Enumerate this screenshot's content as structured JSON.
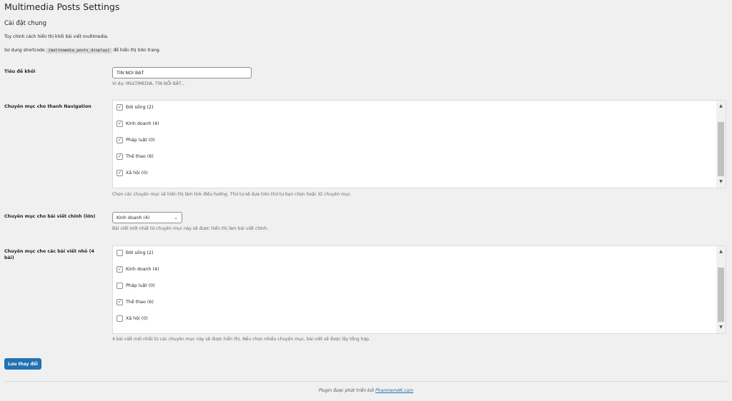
{
  "page_title": "Multimedia Posts Settings",
  "section_title": "Cài đặt chung",
  "intro": {
    "line1": "Tùy chỉnh cách hiển thị khối bài viết multimedia.",
    "line2_prefix": "Sử dụng shortcode",
    "shortcode": "[multimedia_posts_display]",
    "line2_suffix": "để hiển thị trên trang."
  },
  "block_title": {
    "label": "Tiêu đề khối",
    "value": "TIN NỔI BẬT",
    "help": "Ví dụ: MULTIMEDIA, TIN NỔI BẬT..."
  },
  "nav_categories": {
    "label": "Chuyên mục cho thanh Navigation",
    "help": "Chọn các chuyên mục sẽ hiển thị làm link điều hướng. Thứ tự sẽ dựa trên thứ tự bạn chọn hoặc ID chuyên mục.",
    "items": [
      {
        "label": "Đời sống (2)",
        "checked": true
      },
      {
        "label": "Kinh doanh (4)",
        "checked": true
      },
      {
        "label": "Pháp luật (0)",
        "checked": true
      },
      {
        "label": "Thể thao (6)",
        "checked": true
      },
      {
        "label": "Xã hội (0)",
        "checked": true
      }
    ]
  },
  "main_category": {
    "label": "Chuyên mục cho bài viết chính (lớn)",
    "selected": "Kinh doanh (4)",
    "help": "Bài viết mới nhất từ chuyên mục này sẽ được hiển thị làm bài viết chính."
  },
  "small_categories": {
    "label": "Chuyên mục cho các bài viết nhỏ (4 bài)",
    "help": "4 bài viết mới nhất từ các chuyên mục này sẽ được hiển thị. Nếu chọn nhiều chuyên mục, bài viết sẽ được lấy tổng hợp.",
    "items": [
      {
        "label": "Đời sống (2)",
        "checked": false
      },
      {
        "label": "Kinh doanh (4)",
        "checked": true
      },
      {
        "label": "Pháp luật (0)",
        "checked": false
      },
      {
        "label": "Thể thao (6)",
        "checked": true
      },
      {
        "label": "Xã hội (0)",
        "checked": false
      }
    ]
  },
  "save_label": "Lưu thay đổi",
  "footer": {
    "prefix": "Plugin được phát triển bởi",
    "link": "PhanmemAK.com"
  },
  "icons": {
    "check": "check-icon",
    "chevron": "chevron-down-icon",
    "scroll_up": "scroll-up-icon",
    "scroll_down": "scroll-down-icon"
  },
  "colors": {
    "accent": "#2271b1",
    "background": "#f0f0f1"
  }
}
